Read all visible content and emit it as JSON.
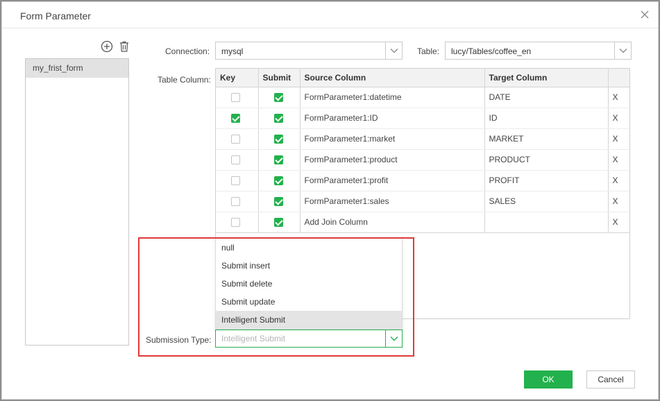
{
  "dialog": {
    "title": "Form Parameter",
    "close_label": "×"
  },
  "form_list": {
    "items": [
      {
        "label": "my_frist_form",
        "selected": true
      }
    ]
  },
  "connection": {
    "label": "Connection:",
    "value": "mysql"
  },
  "table": {
    "label": "Table:",
    "value": "lucy/Tables/coffee_en"
  },
  "table_column": {
    "label": "Table Column:",
    "headers": [
      "Key",
      "Submit",
      "Source Column",
      "Target Column",
      ""
    ],
    "rows": [
      {
        "key": false,
        "submit": true,
        "source": "FormParameter1:datetime",
        "target": "DATE",
        "remove": "X"
      },
      {
        "key": true,
        "submit": true,
        "source": "FormParameter1:ID",
        "target": "ID",
        "remove": "X"
      },
      {
        "key": false,
        "submit": true,
        "source": "FormParameter1:market",
        "target": "MARKET",
        "remove": "X"
      },
      {
        "key": false,
        "submit": true,
        "source": "FormParameter1:product",
        "target": "PRODUCT",
        "remove": "X"
      },
      {
        "key": false,
        "submit": true,
        "source": "FormParameter1:profit",
        "target": "PROFIT",
        "remove": "X"
      },
      {
        "key": false,
        "submit": true,
        "source": "FormParameter1:sales",
        "target": "SALES",
        "remove": "X"
      },
      {
        "key": false,
        "submit": true,
        "source": "Add Join Column",
        "target": "",
        "remove": "X"
      }
    ]
  },
  "submission_type": {
    "label": "Submission Type:",
    "placeholder": "Intelligent Submit",
    "options": [
      "null",
      "Submit insert",
      "Submit delete",
      "Submit update",
      "Intelligent Submit"
    ],
    "selected_index": 4
  },
  "footer": {
    "ok_label": "OK",
    "cancel_label": "Cancel"
  },
  "colors": {
    "accent": "#22b14c",
    "highlight": "#e03a3a"
  }
}
